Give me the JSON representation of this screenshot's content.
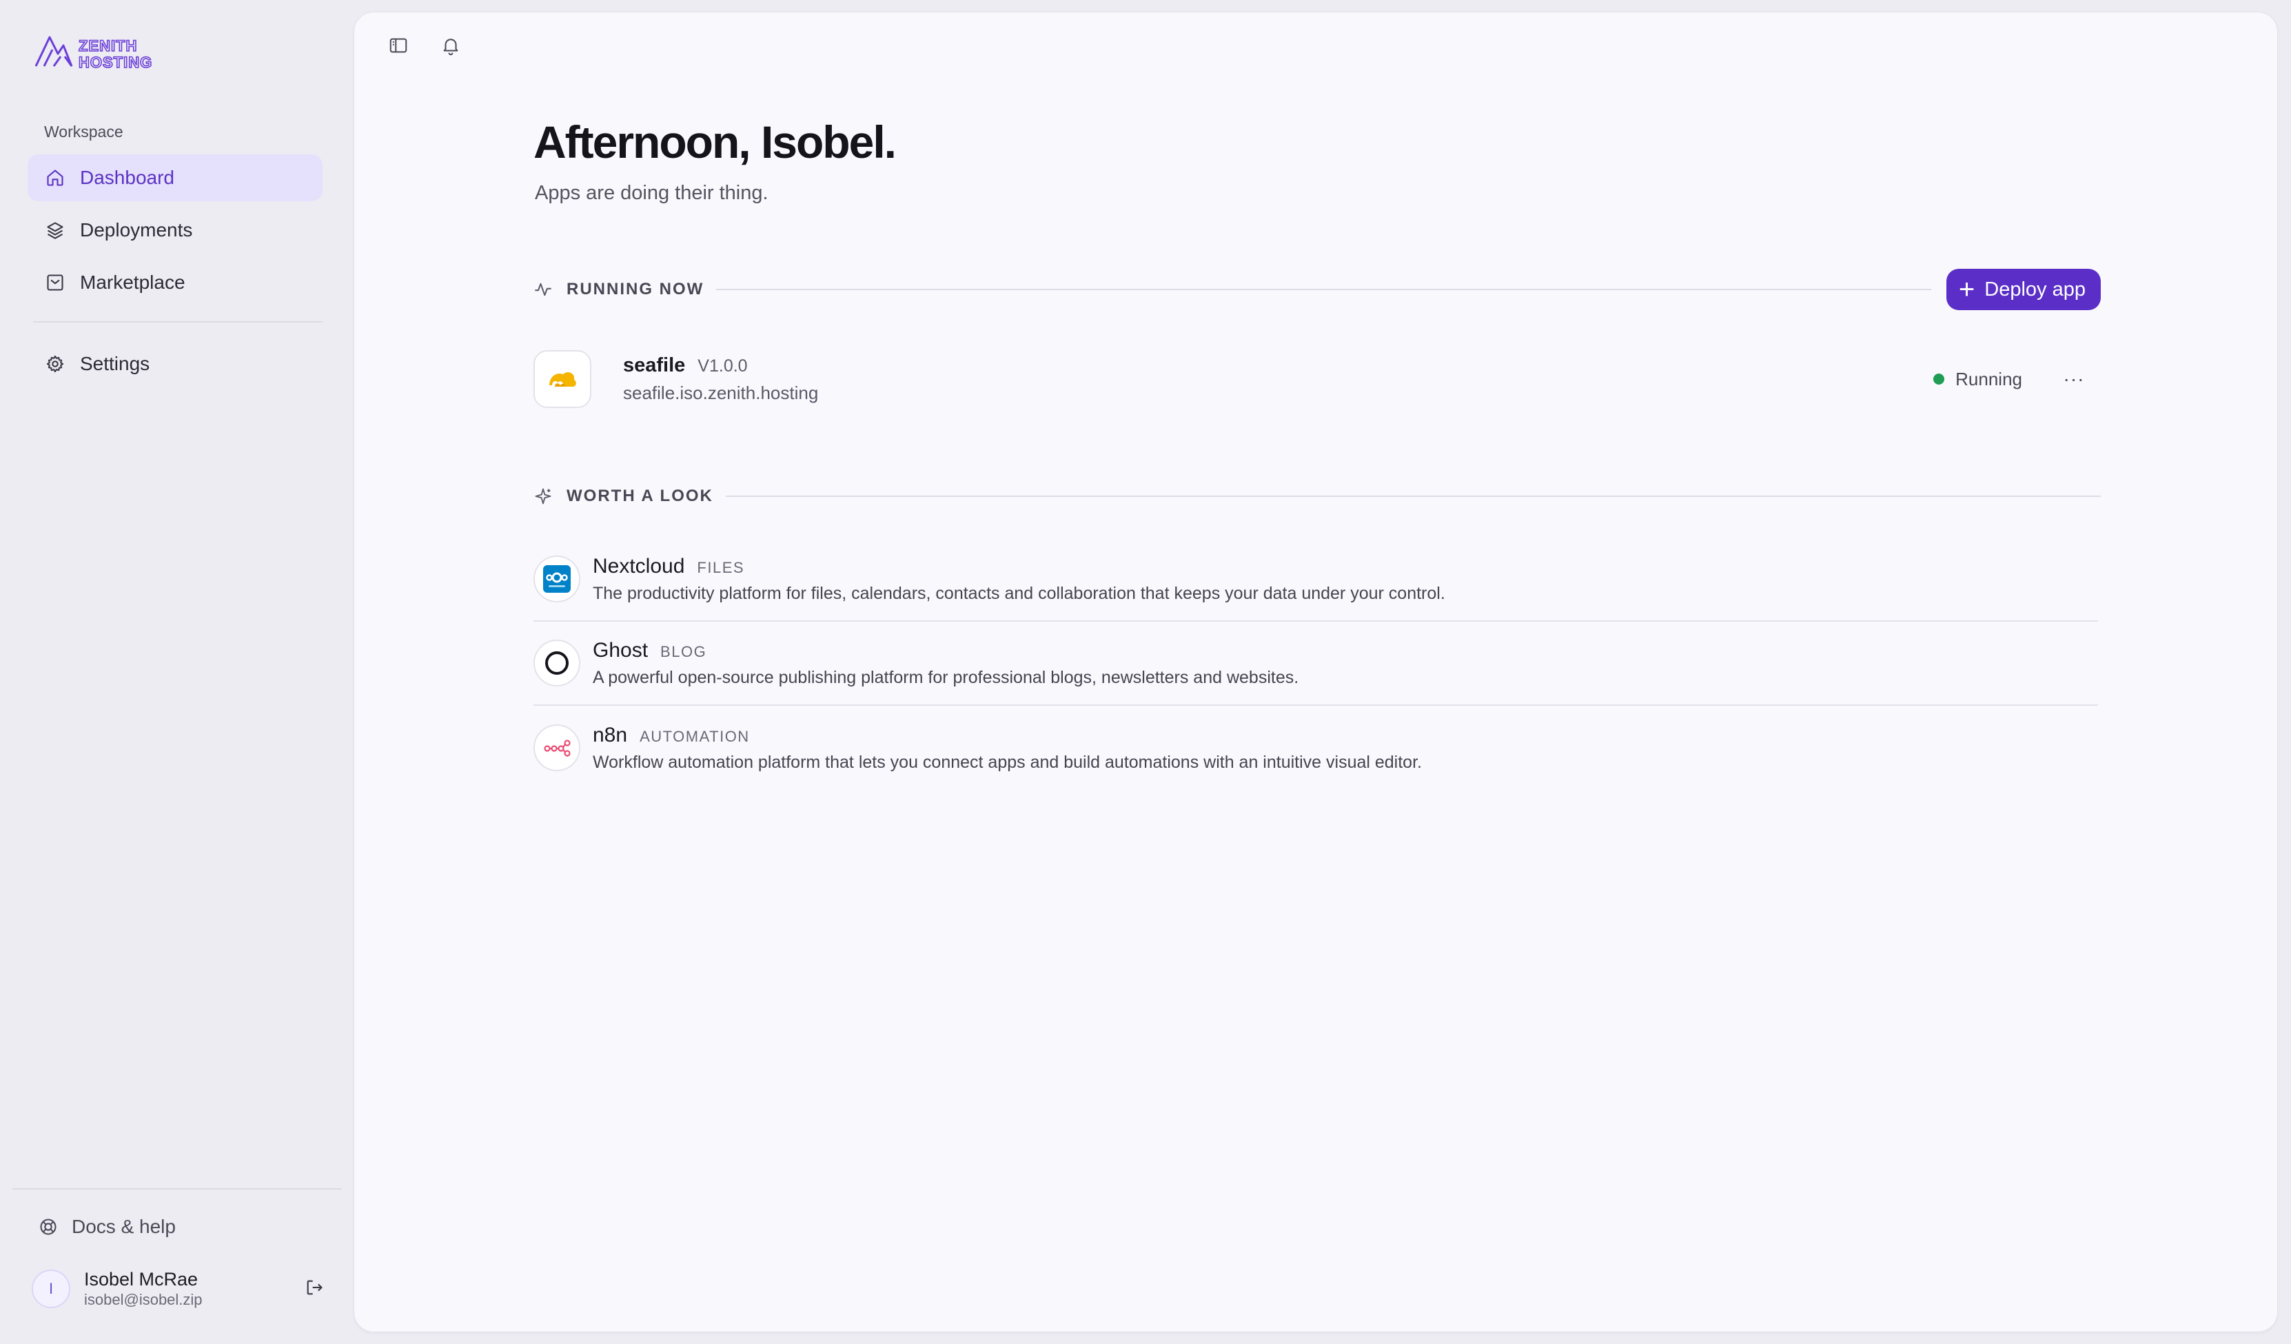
{
  "brand": {
    "name_line1": "ZENITH",
    "name_line2": "HOSTING",
    "accent": "#5b2fc7"
  },
  "sidebar": {
    "section_label": "Workspace",
    "items": [
      {
        "label": "Dashboard",
        "icon": "home-icon",
        "active": true
      },
      {
        "label": "Deployments",
        "icon": "layers-icon",
        "active": false
      },
      {
        "label": "Marketplace",
        "icon": "store-icon",
        "active": false
      }
    ],
    "settings": {
      "label": "Settings",
      "icon": "gear-icon"
    },
    "docs": {
      "label": "Docs & help",
      "icon": "lifebuoy-icon"
    },
    "user": {
      "initial": "I",
      "name": "Isobel McRae",
      "email": "isobel@isobel.zip"
    }
  },
  "topbar": {
    "sidebar_toggle_icon": "sidebar-toggle-icon",
    "notifications_icon": "bell-icon"
  },
  "main": {
    "greeting": "Afternoon, Isobel.",
    "subtitle": "Apps are doing their thing.",
    "running": {
      "title": "RUNNING NOW",
      "deploy_label": "Deploy app",
      "apps": [
        {
          "name": "seafile",
          "version": "V1.0.0",
          "url": "seafile.iso.zenith.hosting",
          "status": "Running",
          "status_color": "#1f9d55",
          "more": "···"
        }
      ]
    },
    "worth_a_look": {
      "title": "WORTH A LOOK",
      "items": [
        {
          "name": "Nextcloud",
          "category": "FILES",
          "description": "The productivity platform for files, calendars, contacts and collaboration that keeps your data under your control."
        },
        {
          "name": "Ghost",
          "category": "BLOG",
          "description": "A powerful open-source publishing platform for professional blogs, newsletters and websites."
        },
        {
          "name": "n8n",
          "category": "AUTOMATION",
          "description": "Workflow automation platform that lets you connect apps and build automations with an intuitive visual editor."
        }
      ]
    }
  }
}
